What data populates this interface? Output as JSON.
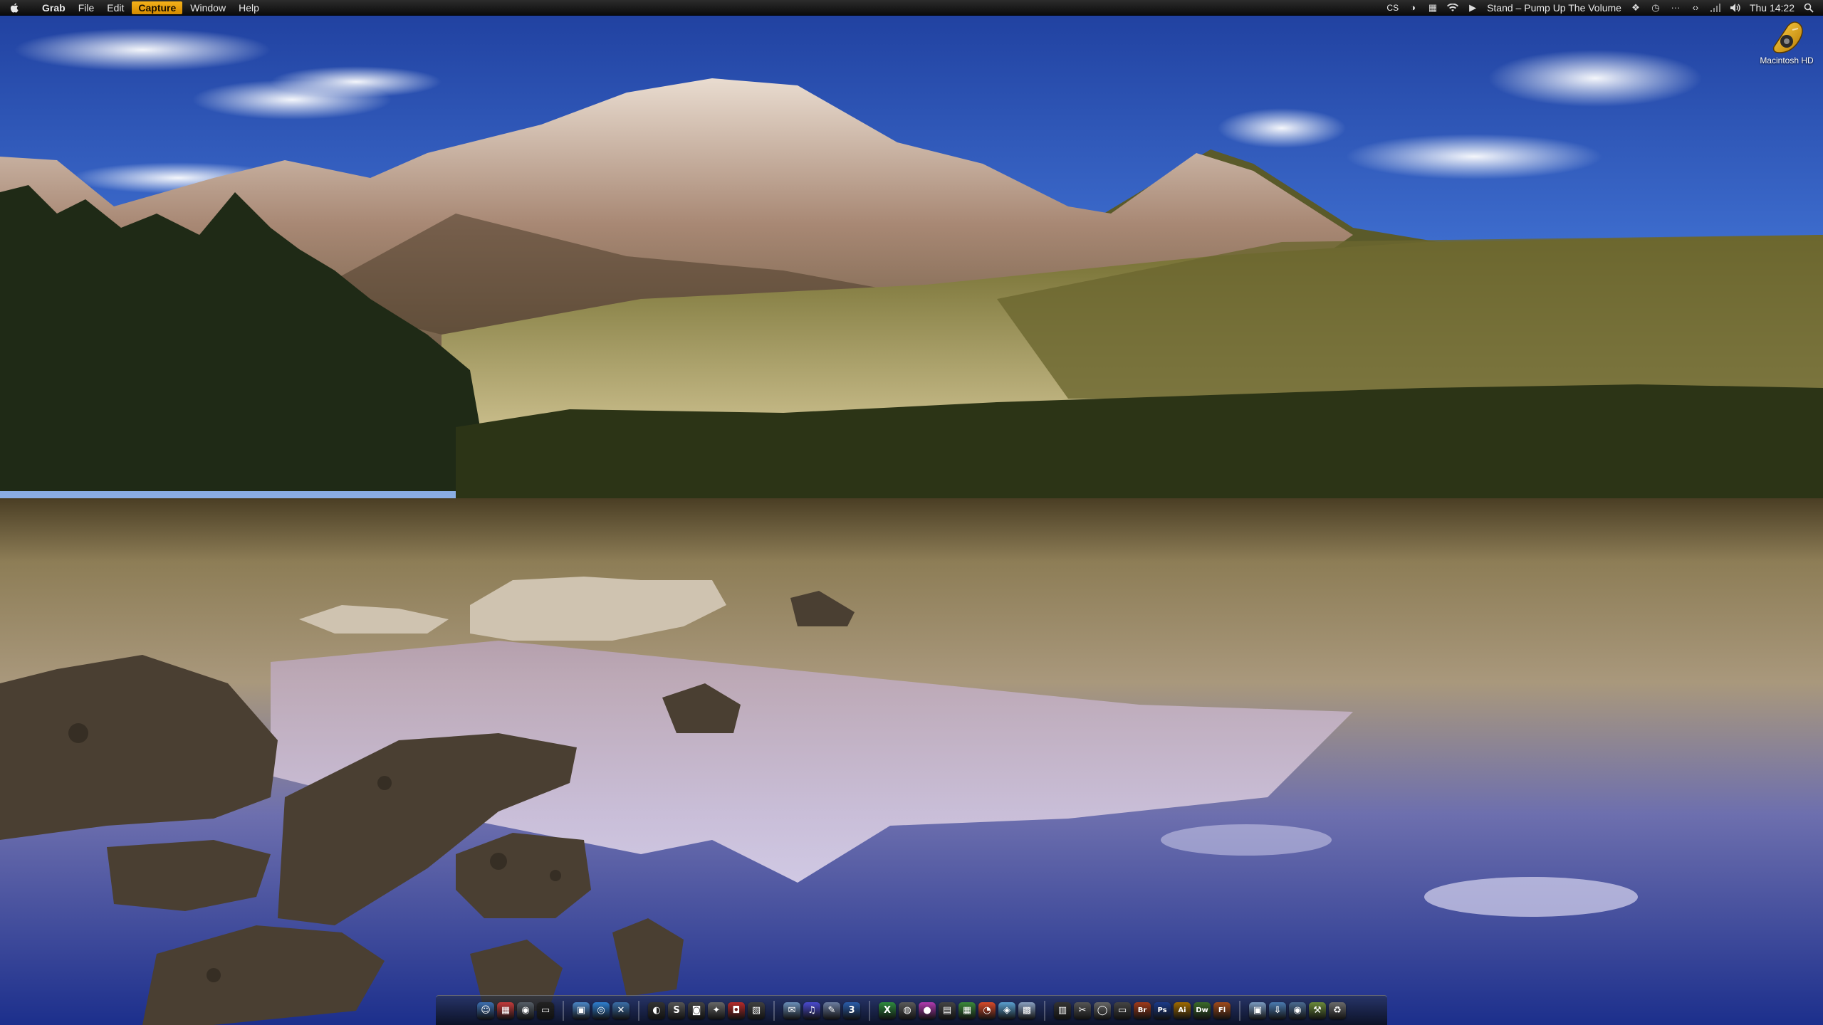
{
  "menubar": {
    "app_name": "Grab",
    "items": [
      "File",
      "Edit",
      "Capture",
      "Window",
      "Help"
    ],
    "active_item": "Capture",
    "tray_text_cs": "CS",
    "now_playing": "Stand – Pump Up The Volume",
    "clock": "Thu 14:22",
    "accent_color": "#f0a80f"
  },
  "desktop": {
    "icons": [
      {
        "label": "Macintosh HD",
        "icon": "hard-drive-icon"
      }
    ]
  },
  "dock": {
    "items": [
      {
        "icon": "finder-icon",
        "color": "#3c6fb0",
        "glyph": "☺"
      },
      {
        "icon": "calendar-icon",
        "color": "#c43b3b",
        "glyph": "▦"
      },
      {
        "icon": "network-icon",
        "color": "#555d66",
        "glyph": "◉"
      },
      {
        "icon": "terminal-icon",
        "color": "#222",
        "glyph": "▭"
      },
      {
        "icon": "sep"
      },
      {
        "icon": "preview-icon",
        "color": "#4a86c5",
        "glyph": "▣"
      },
      {
        "icon": "safari-icon",
        "color": "#2f7fd0",
        "glyph": "◎"
      },
      {
        "icon": "xcode-icon",
        "color": "#3a6ea8",
        "glyph": "✕"
      },
      {
        "icon": "sep"
      },
      {
        "icon": "quicksilver-icon",
        "color": "#333",
        "glyph": "◐"
      },
      {
        "icon": "skype-icon",
        "color": "#555",
        "glyph": "S"
      },
      {
        "icon": "camera-icon",
        "color": "#444",
        "glyph": "◙"
      },
      {
        "icon": "automator-icon",
        "color": "#666",
        "glyph": "✦"
      },
      {
        "icon": "photo-booth-icon",
        "color": "#b52a2a",
        "glyph": "◘"
      },
      {
        "icon": "iphoto-icon",
        "color": "#404040",
        "glyph": "▧"
      },
      {
        "icon": "sep"
      },
      {
        "icon": "mail-icon",
        "color": "#6a8fb8",
        "glyph": "✉"
      },
      {
        "icon": "itunes-icon",
        "color": "#4a4ad0",
        "glyph": "♫"
      },
      {
        "icon": "app-store-icon",
        "color": "#6b7da0",
        "glyph": "✎"
      },
      {
        "icon": "numbers-icon",
        "color": "#2a5caa",
        "glyph": "3"
      },
      {
        "icon": "sep"
      },
      {
        "icon": "excel-icon",
        "color": "#2e8b3e",
        "glyph": "X"
      },
      {
        "icon": "dashboard-icon",
        "color": "#5a5a5a",
        "glyph": "◍"
      },
      {
        "icon": "istat-icon",
        "color": "#b03ab0",
        "glyph": "●"
      },
      {
        "icon": "film-icon",
        "color": "#444",
        "glyph": "▤"
      },
      {
        "icon": "grid-icon",
        "color": "#3a8a3a",
        "glyph": "▦"
      },
      {
        "icon": "chrome-icon",
        "color": "#d84a2a",
        "glyph": "◔"
      },
      {
        "icon": "colors-icon",
        "color": "#5aa0d0",
        "glyph": "◈"
      },
      {
        "icon": "preferences-icon",
        "color": "#8aa0c0",
        "glyph": "▩"
      },
      {
        "icon": "sep"
      },
      {
        "icon": "file-icon",
        "color": "#333",
        "glyph": "▥"
      },
      {
        "icon": "tools-icon",
        "color": "#555",
        "glyph": "✂"
      },
      {
        "icon": "disk-utility-icon",
        "color": "#666",
        "glyph": "◯"
      },
      {
        "icon": "monitor-icon",
        "color": "#444",
        "glyph": "▭"
      },
      {
        "icon": "bridge-icon",
        "color": "#a03a1a",
        "glyph": "Br"
      },
      {
        "icon": "photoshop-icon",
        "color": "#1a3a8a",
        "glyph": "Ps"
      },
      {
        "icon": "illustrator-icon",
        "color": "#a06a00",
        "glyph": "Ai"
      },
      {
        "icon": "dreamweaver-icon",
        "color": "#3a6a2a",
        "glyph": "Dw"
      },
      {
        "icon": "flash-icon",
        "color": "#a04a1a",
        "glyph": "Fl"
      },
      {
        "icon": "sep"
      },
      {
        "icon": "documents-stack-icon",
        "color": "#7a9ac0",
        "glyph": "▣"
      },
      {
        "icon": "downloads-icon",
        "color": "#4a7ab0",
        "glyph": "⇩"
      },
      {
        "icon": "applications-icon",
        "color": "#4a6a90",
        "glyph": "◉"
      },
      {
        "icon": "utilities-icon",
        "color": "#6a8a3a",
        "glyph": "⚒"
      },
      {
        "icon": "trash-icon",
        "color": "#6a6a6a",
        "glyph": "♻"
      }
    ]
  }
}
